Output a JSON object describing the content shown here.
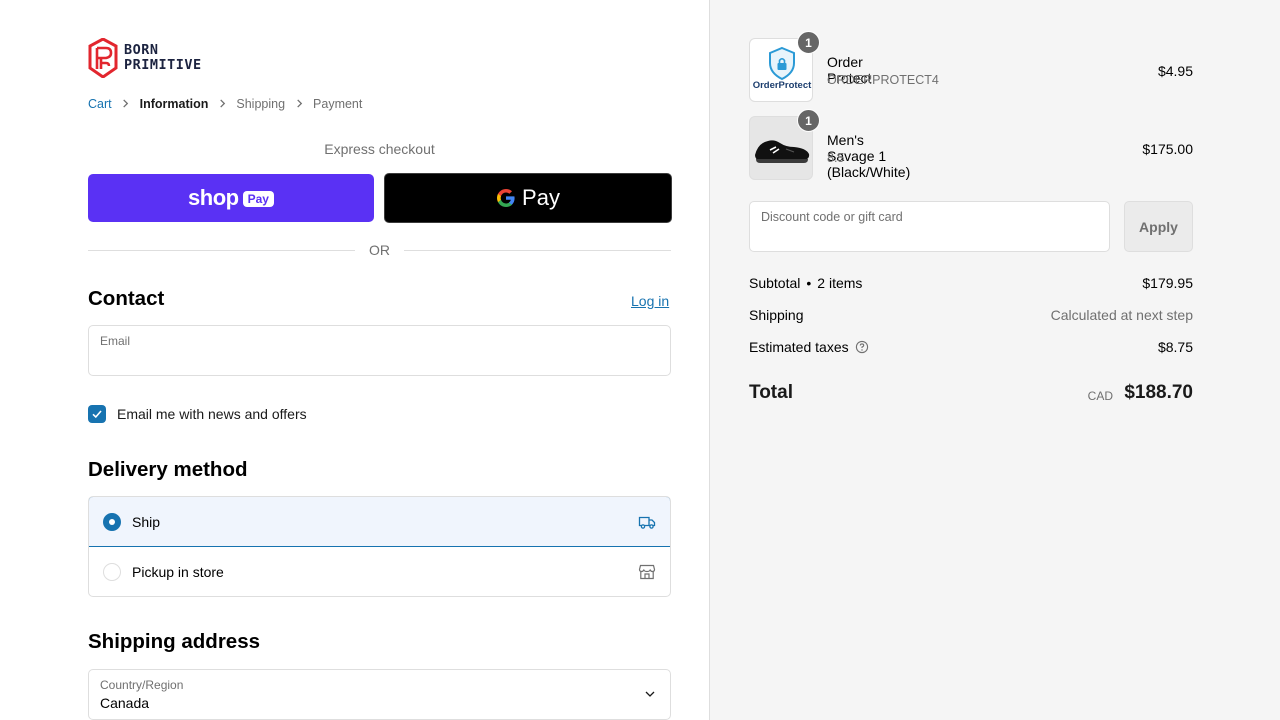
{
  "brand": {
    "line1": "BORN",
    "line2": "PRIMITIVE"
  },
  "breadcrumb": [
    {
      "label": "Cart"
    },
    {
      "label": "Information"
    },
    {
      "label": "Shipping"
    },
    {
      "label": "Payment"
    }
  ],
  "express": {
    "label": "Express checkout",
    "shop_pay": {
      "word": "shop",
      "pill": "Pay"
    },
    "google_pay": {
      "word": "Pay"
    },
    "or": "OR"
  },
  "contact": {
    "title": "Contact",
    "login": "Log in",
    "email_label": "Email",
    "email_value": "",
    "newsletter": "Email me with news and offers",
    "newsletter_checked": true
  },
  "delivery": {
    "title": "Delivery method",
    "options": [
      {
        "label": "Ship",
        "selected": true,
        "icon": "truck-icon"
      },
      {
        "label": "Pickup in store",
        "selected": false,
        "icon": "store-icon"
      }
    ]
  },
  "shipping_address": {
    "title": "Shipping address",
    "country_label": "Country/Region",
    "country_value": "Canada"
  },
  "order": {
    "items": [
      {
        "name": "Order Protect",
        "sub": "ORDERPROTECT4",
        "price": "$4.95",
        "qty": "1",
        "thumb_text": "OrderProtect"
      },
      {
        "name": "Men's Savage 1 (Black/White)",
        "sub": "8.5",
        "price": "$175.00",
        "qty": "1"
      }
    ],
    "discount_label": "Discount code or gift card",
    "apply": "Apply",
    "subtotal_label": "Subtotal",
    "subtotal_items": "2 items",
    "subtotal_value": "$179.95",
    "shipping_label": "Shipping",
    "shipping_value": "Calculated at next step",
    "taxes_label": "Estimated taxes",
    "taxes_value": "$8.75",
    "total_label": "Total",
    "currency": "CAD",
    "total_value": "$188.70"
  },
  "colors": {
    "accent": "#1773b0",
    "shop_pay": "#5a31f4",
    "brand_red": "#e2262e",
    "brand_navy": "#1c2340"
  }
}
